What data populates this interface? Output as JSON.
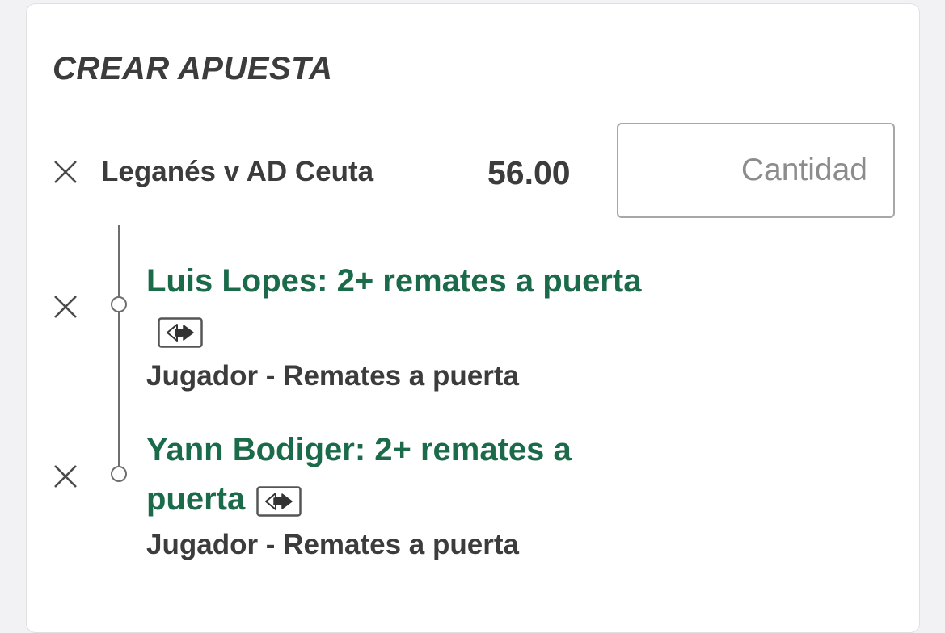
{
  "bet_builder": {
    "title": "CREAR APUESTA",
    "event": {
      "name": "Leganés v AD Ceuta",
      "odds": "56.00"
    },
    "stake_input": {
      "value": "",
      "placeholder": "Cantidad"
    },
    "selections": [
      {
        "title": "Luis Lopes: 2+ remates a puerta",
        "market": "Jugador - Remates a puerta"
      },
      {
        "title": "Yann Bodiger: 2+ remates a puerta",
        "market": "Jugador - Remates a puerta"
      }
    ]
  },
  "colors": {
    "accent_green": "#1b6b4b",
    "text_dark": "#3c3c3c",
    "border_gray": "#a7a7a7"
  },
  "icons": {
    "remove": "close-icon",
    "swap": "swap-arrows-icon"
  }
}
